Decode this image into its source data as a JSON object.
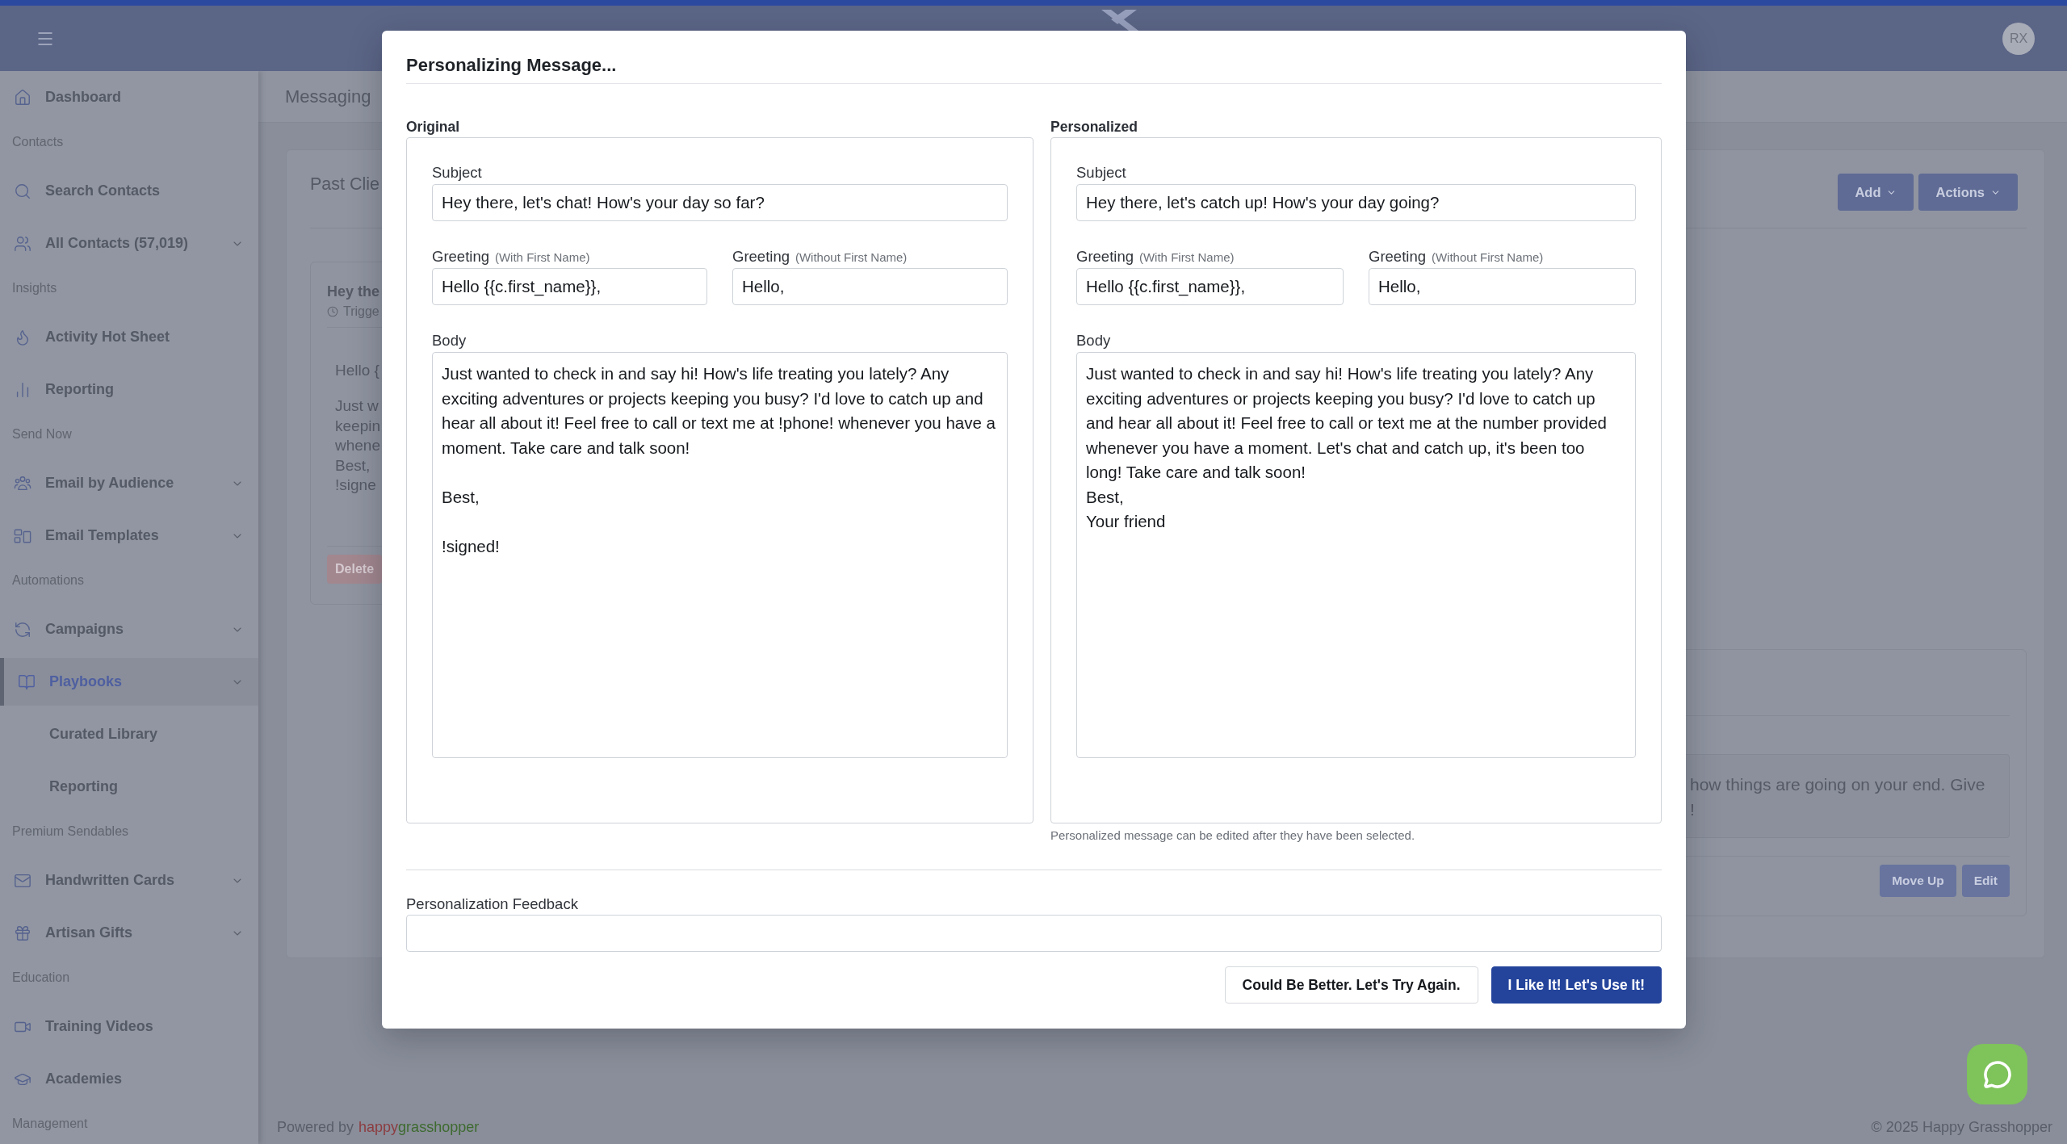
{
  "top_bar": {
    "avatar": "RX"
  },
  "sidebar": {
    "entries": [
      {
        "kind": "link",
        "label": "Dashboard",
        "selected": false,
        "expandable": false
      },
      {
        "kind": "heading",
        "label": "Contacts"
      },
      {
        "kind": "link",
        "label": "Search Contacts",
        "selected": false,
        "expandable": false
      },
      {
        "kind": "link",
        "label": "All Contacts (57,019)",
        "selected": false,
        "expandable": true
      },
      {
        "kind": "heading",
        "label": "Insights"
      },
      {
        "kind": "link",
        "label": "Activity Hot Sheet",
        "selected": false,
        "expandable": false
      },
      {
        "kind": "link",
        "label": "Reporting",
        "selected": false,
        "expandable": false
      },
      {
        "kind": "heading",
        "label": "Send Now"
      },
      {
        "kind": "link",
        "label": "Email by Audience",
        "selected": false,
        "expandable": true
      },
      {
        "kind": "link",
        "label": "Email Templates",
        "selected": false,
        "expandable": true
      },
      {
        "kind": "heading",
        "label": "Automations"
      },
      {
        "kind": "link",
        "label": "Campaigns",
        "selected": false,
        "expandable": true
      },
      {
        "kind": "link",
        "label": "Playbooks",
        "selected": true,
        "expandable": true,
        "children": [
          {
            "label": "Curated Library",
            "selected": false
          },
          {
            "label": "Reporting",
            "selected": false
          }
        ]
      },
      {
        "kind": "heading",
        "label": "Premium Sendables"
      },
      {
        "kind": "link",
        "label": "Handwritten Cards",
        "selected": false,
        "expandable": true
      },
      {
        "kind": "link",
        "label": "Artisan Gifts",
        "selected": false,
        "expandable": true
      },
      {
        "kind": "heading",
        "label": "Education"
      },
      {
        "kind": "link",
        "label": "Training Videos",
        "selected": false,
        "expandable": false
      },
      {
        "kind": "link",
        "label": "Academies",
        "selected": false,
        "expandable": false
      },
      {
        "kind": "heading",
        "label": "Management"
      }
    ]
  },
  "page": {
    "title": "Messaging",
    "card": {
      "title": "Past Clie",
      "buttons": [
        "Add",
        "Actions"
      ],
      "message": {
        "title": "Hey the",
        "trigger": "Trigge",
        "greeting": "Hello {",
        "lines": [
          "Just w",
          "keepin",
          "whene",
          "Best,",
          "!signe"
        ],
        "button": "Delete"
      },
      "preview": {
        "lines": [
          "how things are going on your end. Give",
          "!"
        ],
        "buttons": [
          "Move Up",
          "Edit"
        ]
      }
    }
  },
  "footer": {
    "powered_by": "Powered by",
    "brand_first": "happy",
    "brand_second": "grasshopper",
    "copyright": "© 2025 Happy Grasshopper"
  },
  "dialog": {
    "title": "Personalizing Message...",
    "panels": [
      {
        "heading": "Original",
        "subject_label": "Subject",
        "subject": "Hey there, let's chat! How's your day so far?",
        "greeting_with_label": "Greeting",
        "greeting_with_hint": "(With First Name)",
        "greeting_with": "Hello {{c.first_name}},",
        "greeting_without_label": "Greeting",
        "greeting_without_hint": "(Without First Name)",
        "greeting_without": "Hello,",
        "body_label": "Body",
        "body": "Just wanted to check in and say hi! How's life treating you lately? Any exciting adventures or projects keeping you busy? I'd love to catch up and hear all about it! Feel free to call or text me at !phone! whenever you have a moment. Take care and talk soon!\n\nBest,\n\n!signed!"
      },
      {
        "heading": "Personalized",
        "subject_label": "Subject",
        "subject": "Hey there, let's catch up! How's your day going?",
        "greeting_with_label": "Greeting",
        "greeting_with_hint": "(With First Name)",
        "greeting_with": "Hello {{c.first_name}},",
        "greeting_without_label": "Greeting",
        "greeting_without_hint": "(Without First Name)",
        "greeting_without": "Hello,",
        "body_label": "Body",
        "body": "Just wanted to check in and say hi! How's life treating you lately? Any exciting adventures or projects keeping you busy? I'd love to catch up and hear all about it! Feel free to call or text me at the number provided whenever you have a moment. Let's chat and catch up, it's been too long! Take care and talk soon!\nBest,\nYour friend",
        "note": "Personalized message can be edited after they have been selected."
      }
    ],
    "feedback": {
      "label": "Personalization Feedback"
    },
    "buttons": [
      {
        "label": "Could Be Better. Let's Try Again.",
        "kind": "secondary"
      },
      {
        "label": "I Like It! Let's Use It!",
        "kind": "primary"
      }
    ]
  }
}
